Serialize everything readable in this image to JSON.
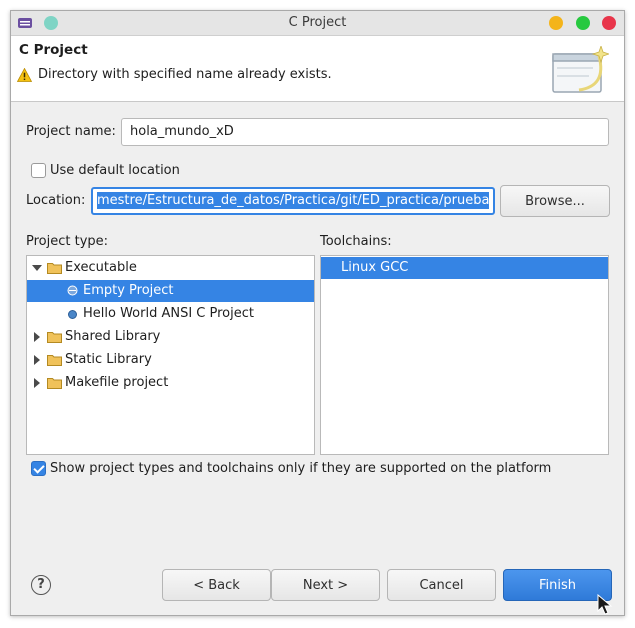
{
  "window": {
    "title": "C Project"
  },
  "banner": {
    "heading": "C Project",
    "message": "Directory with specified name already exists."
  },
  "form": {
    "project_name_label": "Project name:",
    "project_name_value": "hola_mundo_xD",
    "use_default_location_label": "Use default location",
    "use_default_location_checked": false,
    "location_label": "Location:",
    "location_value": "mestre/Estructura_de_datos/Practica/git/ED_practica/prueba",
    "browse_label": "Browse..."
  },
  "project_types": {
    "label": "Project type:",
    "items": [
      {
        "label": "Executable",
        "kind": "folder",
        "expanded": true,
        "level": 0
      },
      {
        "label": "Empty Project",
        "kind": "bullet",
        "selected": true,
        "level": 1
      },
      {
        "label": "Hello World ANSI C Project",
        "kind": "bullet",
        "level": 1
      },
      {
        "label": "Shared Library",
        "kind": "folder",
        "expanded": false,
        "level": 0
      },
      {
        "label": "Static Library",
        "kind": "folder",
        "expanded": false,
        "level": 0
      },
      {
        "label": "Makefile project",
        "kind": "folder",
        "expanded": false,
        "level": 0
      }
    ]
  },
  "toolchains": {
    "label": "Toolchains:",
    "items": [
      {
        "label": "Linux GCC",
        "selected": true
      }
    ]
  },
  "filter": {
    "label": "Show project types and toolchains only if they are supported on the platform",
    "checked": true
  },
  "buttons": {
    "back": "< Back",
    "next": "Next >",
    "cancel": "Cancel",
    "finish": "Finish",
    "help": "?"
  },
  "colors": {
    "accent": "#3584e4",
    "finish": "#2f7ad8",
    "warning": "#f5c211"
  }
}
